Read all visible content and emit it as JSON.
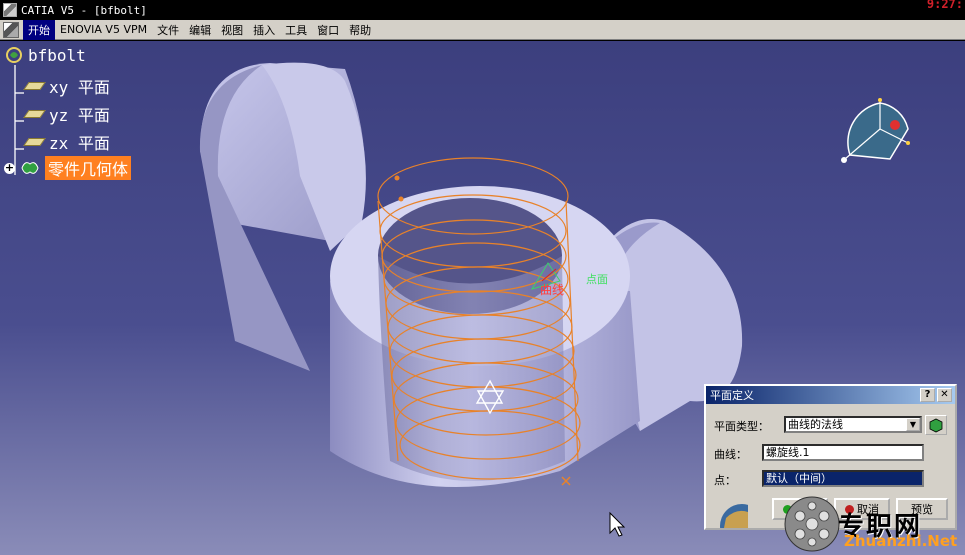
{
  "window": {
    "title": "CATIA V5 - [bfbolt]",
    "clock": "9:27:"
  },
  "menu": {
    "items": [
      "开始",
      "ENOVIA V5 VPM",
      "文件",
      "编辑",
      "视图",
      "插入",
      "工具",
      "窗口",
      "帮助"
    ]
  },
  "tree": {
    "root": "bfbolt",
    "children": [
      "xy 平面",
      "yz 平面",
      "zx 平面"
    ],
    "body": "零件几何体"
  },
  "viewport": {
    "curve_tag": "曲线",
    "point_tag": "点面"
  },
  "dialog": {
    "title": "平面定义",
    "help_btn": "?",
    "close_btn": "✕",
    "plane_type_label": "平面类型：",
    "plane_type_value": "曲线的法线",
    "curve_label": "曲线：",
    "curve_value": "螺旋线.1",
    "point_label": "点：",
    "point_value": "默认（中间）",
    "ok_label": "确定",
    "cancel_label": "取消",
    "preview_label": "预览"
  },
  "watermark": {
    "text": "专职网",
    "url": "Zhuanzhi.Net"
  },
  "colors": {
    "bg_top": "#3c3f7e",
    "selection": "#ff8020",
    "helix": "#e8822a",
    "part": "#c8c8e8"
  }
}
